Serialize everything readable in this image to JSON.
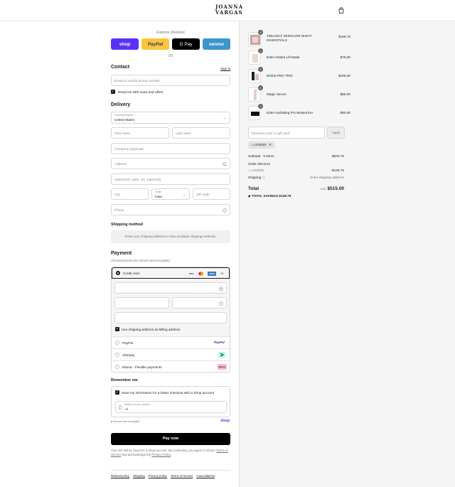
{
  "brand": {
    "line1": "JOANNA",
    "line2": "VARGAS"
  },
  "express": {
    "title": "Express checkout",
    "buttons": [
      "shop",
      "PayPal",
      "G Pay",
      "venmo"
    ],
    "or": "OR"
  },
  "contact": {
    "heading": "Contact",
    "sign_in": "Sign in",
    "email_placeholder": "Email or mobile phone number",
    "news_label": "Email me with news and offers"
  },
  "delivery": {
    "heading": "Delivery",
    "country_label": "Country/Region",
    "country_value": "United States",
    "first_name": "First name",
    "last_name": "Last name",
    "company": "Company (optional)",
    "address": "Address",
    "apartment": "Apartment, suite, etc. (optional)",
    "city": "City",
    "state_label": "State",
    "state_value": "Iowa",
    "zip": "ZIP code",
    "phone": "Phone"
  },
  "shipping": {
    "heading": "Shipping method",
    "message": "Enter your shipping address to view available shipping methods."
  },
  "payment": {
    "heading": "Payment",
    "subtitle": "All transactions are secure and encrypted.",
    "credit_card": "Credit card",
    "card_badges": [
      "VISA",
      "MC",
      "AMEX",
      "+5"
    ],
    "billing_label": "Use shipping address as billing address",
    "paypal": "PayPal",
    "paypal_badge": "PayPal",
    "afterpay": "Afterpay",
    "klarna": "Klarna - Flexible payments",
    "klarna_badge": "Klarna."
  },
  "remember": {
    "heading": "Remember me",
    "save_label": "Save my information for a faster checkout with a Shop account",
    "mobile_label": "Mobile phone number",
    "mobile_value": "+1"
  },
  "secure": {
    "text": "Secure and encrypted",
    "shop": "shop"
  },
  "pay_now": "Pay now",
  "legal": {
    "text1": "Your info will be saved to a Shop account. By continuing, you agree to Shop's",
    "terms": "Terms of Service",
    "text2": "and acknowledge the",
    "privacy": "Privacy Policy",
    "text3": "."
  },
  "footer": [
    "Refund policy",
    "Shipping",
    "Privacy policy",
    "Terms of service",
    "Cancellations"
  ],
  "cart": {
    "items": [
      {
        "name": "TWILIGHT SKINCARE NIGHT ESSENTIALS",
        "price": "$196.75",
        "qty": "1"
      },
      {
        "name": "Eden Instant Lift Mask",
        "price": "$75.00",
        "qty": "1"
      },
      {
        "name": "EDEN PRO TRIO",
        "price": "$195.00",
        "qty": "1"
      },
      {
        "name": "Magic Serum",
        "price": "$85.00",
        "qty": "1"
      },
      {
        "name": "Eden Hydrating Pro Moisturizer",
        "price": "$90.00",
        "qty": "1"
      }
    ],
    "discount_placeholder": "Discount code or gift card",
    "apply": "Apply",
    "code_tag": "LOVE20",
    "subtotal_label": "Subtotal · 5 items",
    "subtotal": "$643.75",
    "order_discount_label": "Order discount",
    "discount_code": "LOVE20",
    "discount_value": "- $128.75",
    "shipping_label": "Shipping",
    "shipping_value": "Enter shipping address",
    "total_label": "Total",
    "currency": "USD",
    "total": "$515.00",
    "savings_label": "TOTAL SAVINGS",
    "savings": "$128.75"
  }
}
